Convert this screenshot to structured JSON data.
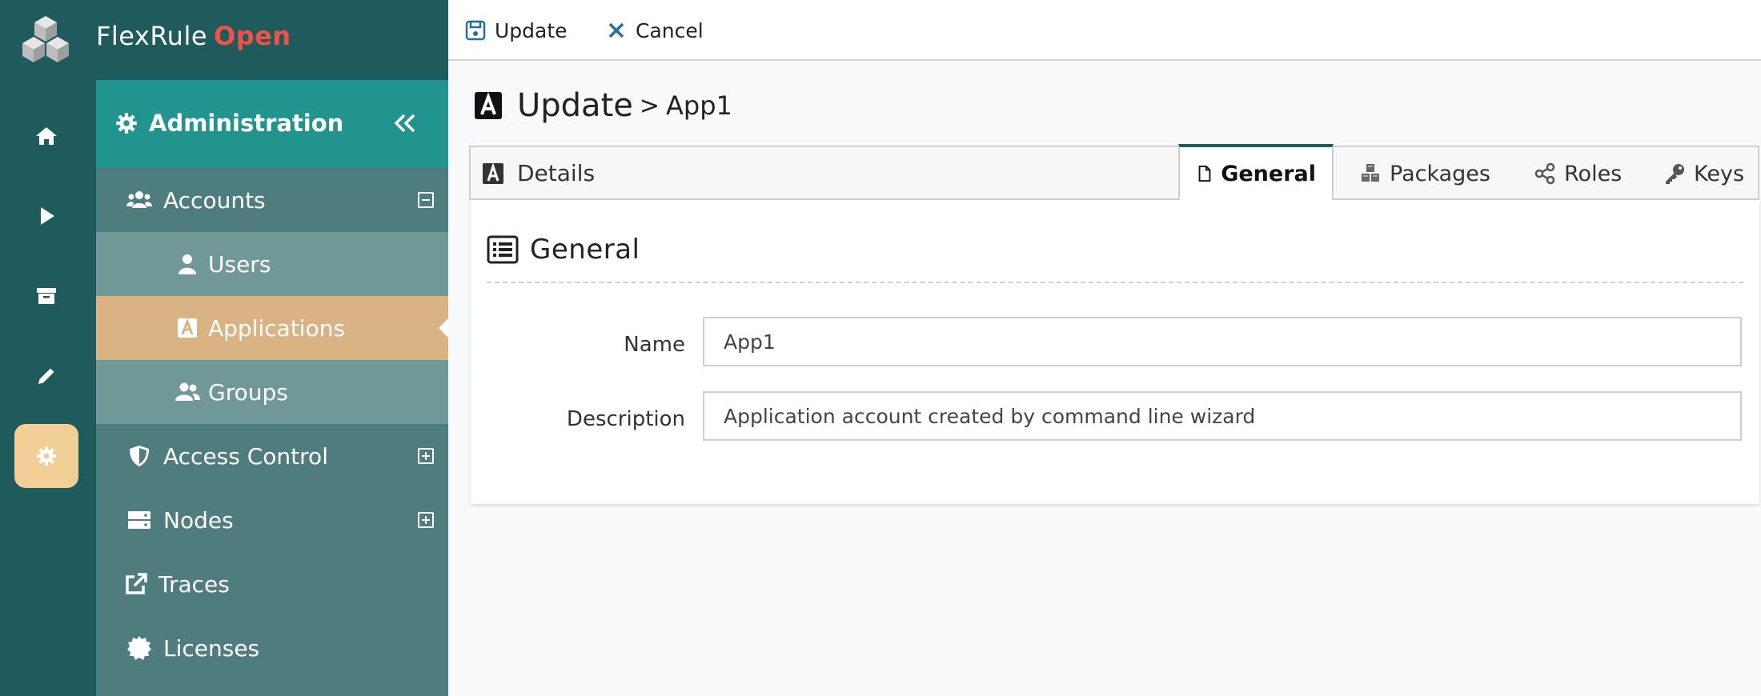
{
  "brand": {
    "name": "FlexRule",
    "accent": "Open"
  },
  "rail": {
    "items": [
      {
        "icon": "home-icon"
      },
      {
        "icon": "play-icon"
      },
      {
        "icon": "archive-icon"
      },
      {
        "icon": "pencil-icon"
      },
      {
        "icon": "gear-icon",
        "active": true
      }
    ]
  },
  "nav": {
    "title": "Administration",
    "items": [
      {
        "label": "Accounts",
        "icon": "users-icon",
        "toggle": "minus"
      },
      {
        "label": "Users",
        "icon": "user-icon"
      },
      {
        "label": "Applications",
        "icon": "app-icon",
        "selected": true
      },
      {
        "label": "Groups",
        "icon": "group-icon"
      },
      {
        "label": "Access Control",
        "icon": "shield-icon",
        "toggle": "plus"
      },
      {
        "label": "Nodes",
        "icon": "server-icon",
        "toggle": "plus"
      },
      {
        "label": "Traces",
        "icon": "external-link-icon"
      },
      {
        "label": "Licenses",
        "icon": "certificate-icon"
      }
    ]
  },
  "toolbar": {
    "update_label": "Update",
    "cancel_label": "Cancel"
  },
  "page": {
    "title": "Update",
    "separator": ">",
    "subtitle": "App1"
  },
  "tabs": {
    "details_label": "Details",
    "items": [
      {
        "label": "General",
        "icon": "file-icon",
        "active": true
      },
      {
        "label": "Packages",
        "icon": "cubes-icon"
      },
      {
        "label": "Roles",
        "icon": "share-icon"
      },
      {
        "label": "Keys",
        "icon": "key-icon"
      }
    ]
  },
  "form": {
    "section_title": "General",
    "name_label": "Name",
    "name_value": "App1",
    "description_label": "Description",
    "description_value": "Application account created by command line wizard"
  },
  "colors": {
    "sidebar_dark": "#1f5a5c",
    "nav_header": "#21948d",
    "nav_bg": "#4f7c7d",
    "nav_sub": "#6f9897",
    "nav_selected": "#d9b383",
    "rail_active": "#f2cf96",
    "brand_accent": "#f0524a"
  }
}
